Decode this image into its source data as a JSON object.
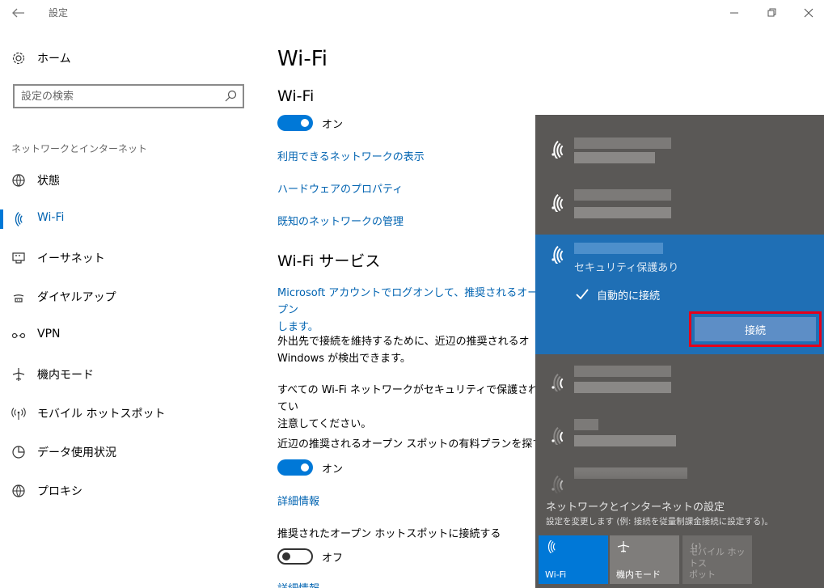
{
  "window": {
    "title": "設定"
  },
  "sidebar": {
    "home_label": "ホーム",
    "search_placeholder": "設定の検索",
    "section_label": "ネットワークとインターネット",
    "items": [
      {
        "label": "状態",
        "icon": "globe-status-icon"
      },
      {
        "label": "Wi-Fi",
        "icon": "wifi-icon",
        "active": true
      },
      {
        "label": "イーサネット",
        "icon": "ethernet-icon"
      },
      {
        "label": "ダイヤルアップ",
        "icon": "dialup-icon"
      },
      {
        "label": "VPN",
        "icon": "vpn-icon"
      },
      {
        "label": "機内モード",
        "icon": "airplane-icon"
      },
      {
        "label": "モバイル ホットスポット",
        "icon": "hotspot-icon"
      },
      {
        "label": "データ使用状況",
        "icon": "data-usage-icon"
      },
      {
        "label": "プロキシ",
        "icon": "globe-icon"
      }
    ]
  },
  "main": {
    "page_title": "Wi-Fi",
    "wifi_heading": "Wi-Fi",
    "wifi_toggle_label": "オン",
    "link_available": "利用できるネットワークの表示",
    "link_hardware": "ハードウェアのプロパティ",
    "link_known": "既知のネットワークの管理",
    "services_heading": "Wi-Fi サービス",
    "ms_account_text": "Microsoft アカウントでログオンして、推奨されるオープン\nします。",
    "para1": "外出先で接続を維持するために、近辺の推奨されるオ\nWindows が検出できます。",
    "para2": "すべての Wi-Fi ネットワークがセキュリティで保護されてい\n注意してください。",
    "paid_plan_label": "近辺の推奨されるオープン スポットの有料プランを探す",
    "paid_plan_toggle_label": "オン",
    "details_link_1": "詳細情報",
    "hotspot_label": "推奨されたオープン ホットスポットに接続する",
    "hotspot_toggle_label": "オフ",
    "details_link_2": "詳細情報"
  },
  "flyout": {
    "security_label": "セキュリティ保護あり",
    "auto_connect_label": "自動的に接続",
    "connect_button": "接続",
    "settings_title": "ネットワークとインターネットの設定",
    "settings_sub": "設定を変更します (例: 接続を従量制課金接続に設定する)。",
    "tiles": [
      {
        "label": "Wi-Fi",
        "icon": "wifi-icon"
      },
      {
        "label": "機内モード",
        "icon": "airplane-icon"
      },
      {
        "label": "モバイル ホットス\nポット",
        "icon": "hotspot-icon"
      }
    ]
  },
  "colors": {
    "accent": "#0078d7",
    "link": "#0063b1",
    "flyout_bg": "#5a5856",
    "selected_bg": "#1f6fb5",
    "highlight_box": "#e4001b"
  }
}
